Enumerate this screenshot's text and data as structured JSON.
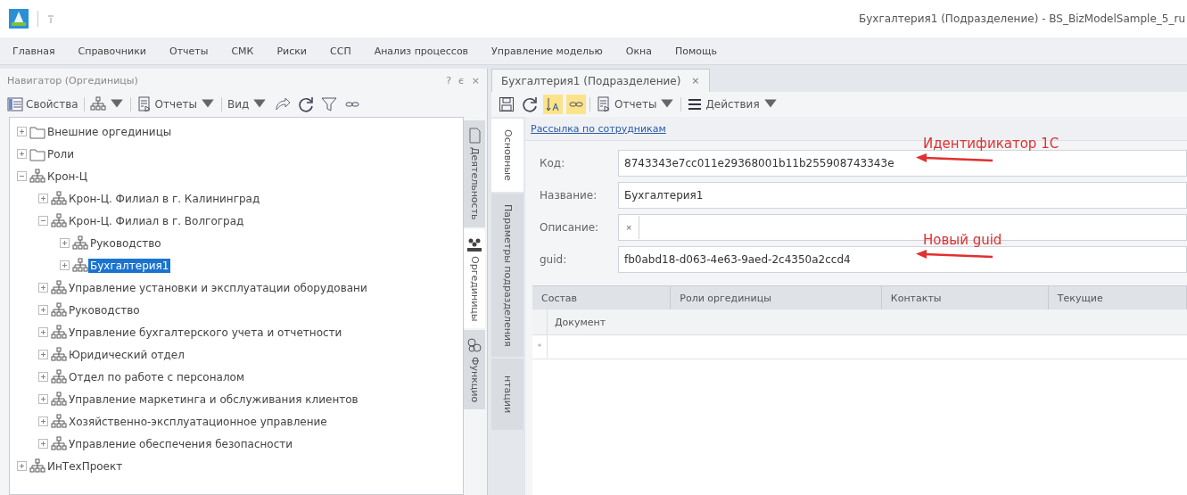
{
  "window": {
    "title": "Бухгалтерия1 (Подразделение) - BS_BizModelSample_5_ru"
  },
  "menu": [
    "Главная",
    "Справочники",
    "Отчеты",
    "СМК",
    "Риски",
    "ССП",
    "Анализ процессов",
    "Управление моделью",
    "Окна",
    "Помощь"
  ],
  "navigator": {
    "title": "Навигатор (Оргединицы)",
    "header_buttons": [
      "?",
      "ϵ",
      "×"
    ],
    "toolbar": [
      {
        "kind": "button",
        "label": "Свойства"
      },
      {
        "kind": "dropdown"
      },
      {
        "kind": "dropdown",
        "label": "Отчеты"
      },
      {
        "kind": "dropdown",
        "label": "Вид"
      },
      {
        "kind": "button"
      },
      {
        "kind": "button"
      },
      {
        "kind": "button"
      },
      {
        "kind": "button"
      }
    ],
    "tree": [
      {
        "label": "Внешние оргединицы",
        "kind": "folder",
        "expanded": false,
        "selected": false
      },
      {
        "label": "Роли",
        "kind": "folder",
        "expanded": false,
        "selected": false
      },
      {
        "label": "Крон-Ц",
        "kind": "org",
        "expanded": true,
        "selected": false,
        "children": [
          {
            "label": "Крон-Ц. Филиал в г. Калининград",
            "kind": "org",
            "expanded": false,
            "selected": false
          },
          {
            "label": "Крон-Ц. Филиал в г. Волгоград",
            "kind": "org",
            "expanded": true,
            "selected": false,
            "children": [
              {
                "label": "Руководство",
                "kind": "org",
                "expanded": false,
                "selected": false
              },
              {
                "label": "Бухгалтерия1",
                "kind": "org",
                "expanded": false,
                "selected": true
              }
            ]
          },
          {
            "label": "Управление установки и эксплуатации оборудовани",
            "kind": "org",
            "expanded": false,
            "selected": false
          },
          {
            "label": "Руководство",
            "kind": "org",
            "expanded": false,
            "selected": false
          },
          {
            "label": "Управление бухгалтерского учета и отчетности",
            "kind": "org",
            "expanded": false,
            "selected": false
          },
          {
            "label": "Юридический отдел",
            "kind": "org",
            "expanded": false,
            "selected": false
          },
          {
            "label": "Отдел по работе с персоналом",
            "kind": "org",
            "expanded": false,
            "selected": false
          },
          {
            "label": "Управление маркетинга и обслуживания клиентов",
            "kind": "org",
            "expanded": false,
            "selected": false
          },
          {
            "label": "Хозяйственно-эксплуатационное управление",
            "kind": "org",
            "expanded": false,
            "selected": false
          },
          {
            "label": "Управление обеспечения безопасности",
            "kind": "org",
            "expanded": false,
            "selected": false
          }
        ]
      },
      {
        "label": "ИнТехПроект",
        "kind": "org",
        "expanded": false,
        "selected": false
      }
    ],
    "side_tabs": [
      {
        "label": "Деятельность",
        "selected": false
      },
      {
        "label": "Оргединицы",
        "selected": true
      },
      {
        "label": "Функцио",
        "selected": false
      }
    ]
  },
  "document": {
    "tab": {
      "label": "Бухгалтерия1 (Подразделение)",
      "close": "×"
    },
    "toolbar": [
      {
        "kind": "button",
        "active": false
      },
      {
        "kind": "button",
        "active": false
      },
      {
        "kind": "button",
        "active": true
      },
      {
        "kind": "button",
        "active": true
      },
      {
        "kind": "dropdown",
        "label": "Отчеты",
        "active": false
      },
      {
        "kind": "dropdown",
        "label": "Действия",
        "active": false
      }
    ],
    "side_tabs": [
      {
        "label": "Основные",
        "selected": true
      },
      {
        "label": "Параметры подразделения",
        "selected": false
      },
      {
        "label": "нтации",
        "selected": false
      }
    ],
    "link": "Рассылка по сотрудникам",
    "fields": [
      {
        "label": "Код:",
        "value": "8743343e7cc011e29368001b11b255908743343e",
        "annotation": "Идентификатор 1С"
      },
      {
        "label": "Название:",
        "value": "Бухгалтерия1"
      },
      {
        "label": "Описание:",
        "clear": "×"
      },
      {
        "label": "guid:",
        "value": "fb0abd18-d063-4e63-9aed-2c4350a2ccd4",
        "annotation": "Новый guid"
      }
    ],
    "subtabs": [
      "Состав",
      "Роли оргединицы",
      "Контакты",
      "Текущие"
    ],
    "grid": {
      "columns": [
        "Документ"
      ],
      "new_row_marker": "*"
    }
  }
}
